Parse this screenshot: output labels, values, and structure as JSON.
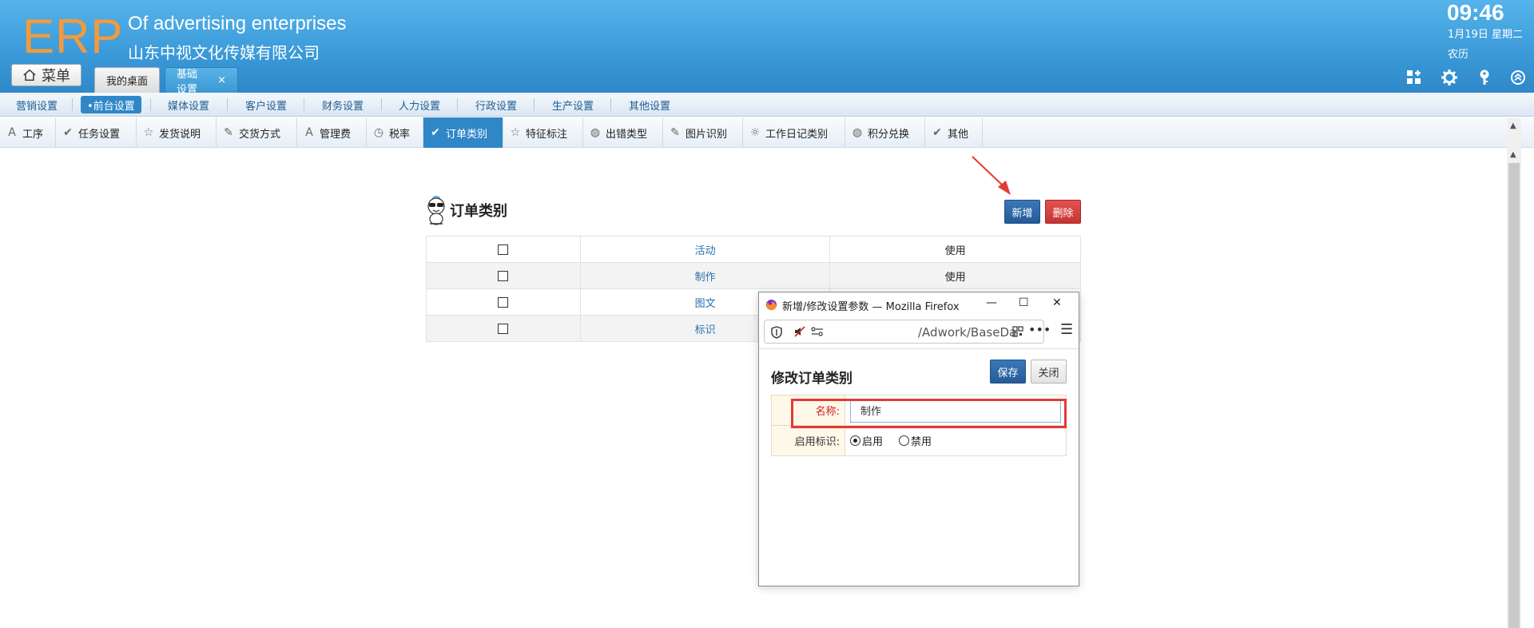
{
  "header": {
    "logo": "ERP",
    "brand_en": "Of advertising enterprises",
    "brand_cn": "山东中视文化传媒有限公司",
    "clock_time": "09:46",
    "clock_date": "1月19日 星期二",
    "clock_lunar": "农历",
    "menu_label": "菜单",
    "tabs": [
      {
        "label": "我的桌面"
      },
      {
        "label": "基础设置",
        "close": "×"
      }
    ],
    "icons": [
      "grid-add-icon",
      "gear-icon",
      "key-icon",
      "chevron-up-circle-icon"
    ]
  },
  "subnav": {
    "items": [
      {
        "label": "营销设置"
      },
      {
        "label": "•前台设置",
        "active": true
      },
      {
        "label": "媒体设置"
      },
      {
        "label": "客户设置"
      },
      {
        "label": "财务设置"
      },
      {
        "label": "人力设置"
      },
      {
        "label": "行政设置"
      },
      {
        "label": "生产设置"
      },
      {
        "label": "其他设置"
      }
    ]
  },
  "toolbar": {
    "items": [
      {
        "label": "工序",
        "icon": "A"
      },
      {
        "label": "任务设置",
        "icon": "✔"
      },
      {
        "label": "发货说明",
        "icon": "☆"
      },
      {
        "label": "交货方式",
        "icon": "✎"
      },
      {
        "label": "管理费",
        "icon": "A"
      },
      {
        "label": "税率",
        "icon": "◷"
      },
      {
        "label": "订单类别",
        "icon": "✔",
        "active": true
      },
      {
        "label": "特征标注",
        "icon": "☆"
      },
      {
        "label": "出错类型",
        "icon": "◍"
      },
      {
        "label": "图片识别",
        "icon": "✎"
      },
      {
        "label": "工作日记类别",
        "icon": "☼"
      },
      {
        "label": "积分兑换",
        "icon": "◍"
      },
      {
        "label": "其他",
        "icon": "✔"
      }
    ]
  },
  "main": {
    "title": "订单类别",
    "add_label": "新增",
    "delete_label": "删除",
    "rows": [
      {
        "name": "活动",
        "status": "使用"
      },
      {
        "name": "制作",
        "status": "使用"
      },
      {
        "name": "图文",
        "status": ""
      },
      {
        "name": "标识",
        "status": ""
      }
    ]
  },
  "popup": {
    "window_title": "新增/修改设置参数 — Mozilla Firefox",
    "url": "/Adwork/BaseDa",
    "form_title": "修改订单类别",
    "save_label": "保存",
    "close_label": "关闭",
    "name_label": "名称:",
    "name_value": "制作",
    "enable_label": "启用标识:",
    "enable_on": "启用",
    "enable_off": "禁用"
  },
  "colors": {
    "header_blue": "#3a99d8",
    "logo_orange": "#f39a3c",
    "active_blue": "#2f87c8",
    "danger_red": "#c73333",
    "highlight_red": "#e53935"
  }
}
